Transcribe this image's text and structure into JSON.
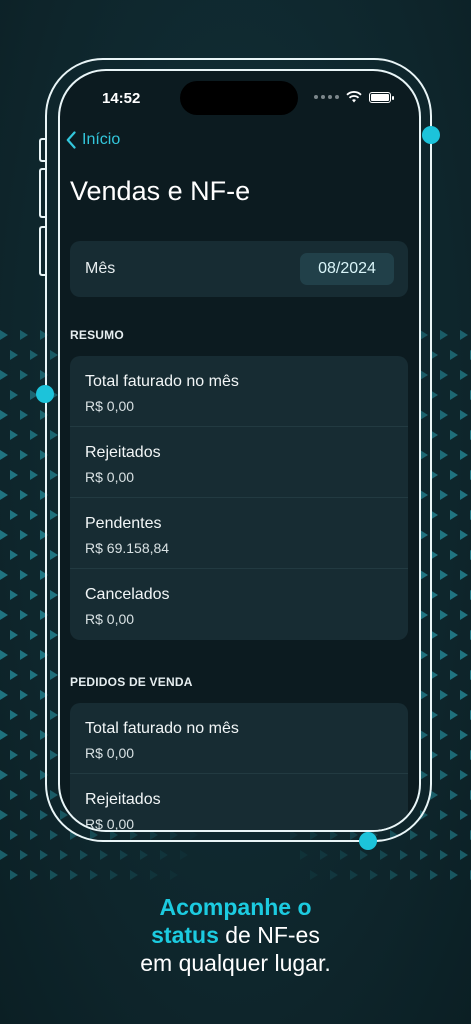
{
  "status_bar": {
    "time": "14:52"
  },
  "nav": {
    "back_label": "Início"
  },
  "page": {
    "title": "Vendas e NF-e"
  },
  "month": {
    "label": "Mês",
    "value": "08/2024"
  },
  "sections": [
    {
      "header": "RESUMO",
      "rows": [
        {
          "label": "Total faturado no mês",
          "value": "R$ 0,00"
        },
        {
          "label": "Rejeitados",
          "value": "R$ 0,00"
        },
        {
          "label": "Pendentes",
          "value": "R$ 69.158,84"
        },
        {
          "label": "Cancelados",
          "value": "R$ 0,00"
        }
      ]
    },
    {
      "header": "PEDIDOS DE VENDA",
      "rows": [
        {
          "label": "Total faturado no mês",
          "value": "R$ 0,00"
        },
        {
          "label": "Rejeitados",
          "value": "R$ 0,00"
        }
      ]
    }
  ],
  "caption": {
    "line1_accent": "Acompanhe o",
    "line2_accent": "status",
    "line2_rest": " de NF-es",
    "line3": "em qualquer lugar."
  },
  "colors": {
    "accent": "#1ccbe0",
    "background": "#0f2a31",
    "card": "#172c33"
  }
}
